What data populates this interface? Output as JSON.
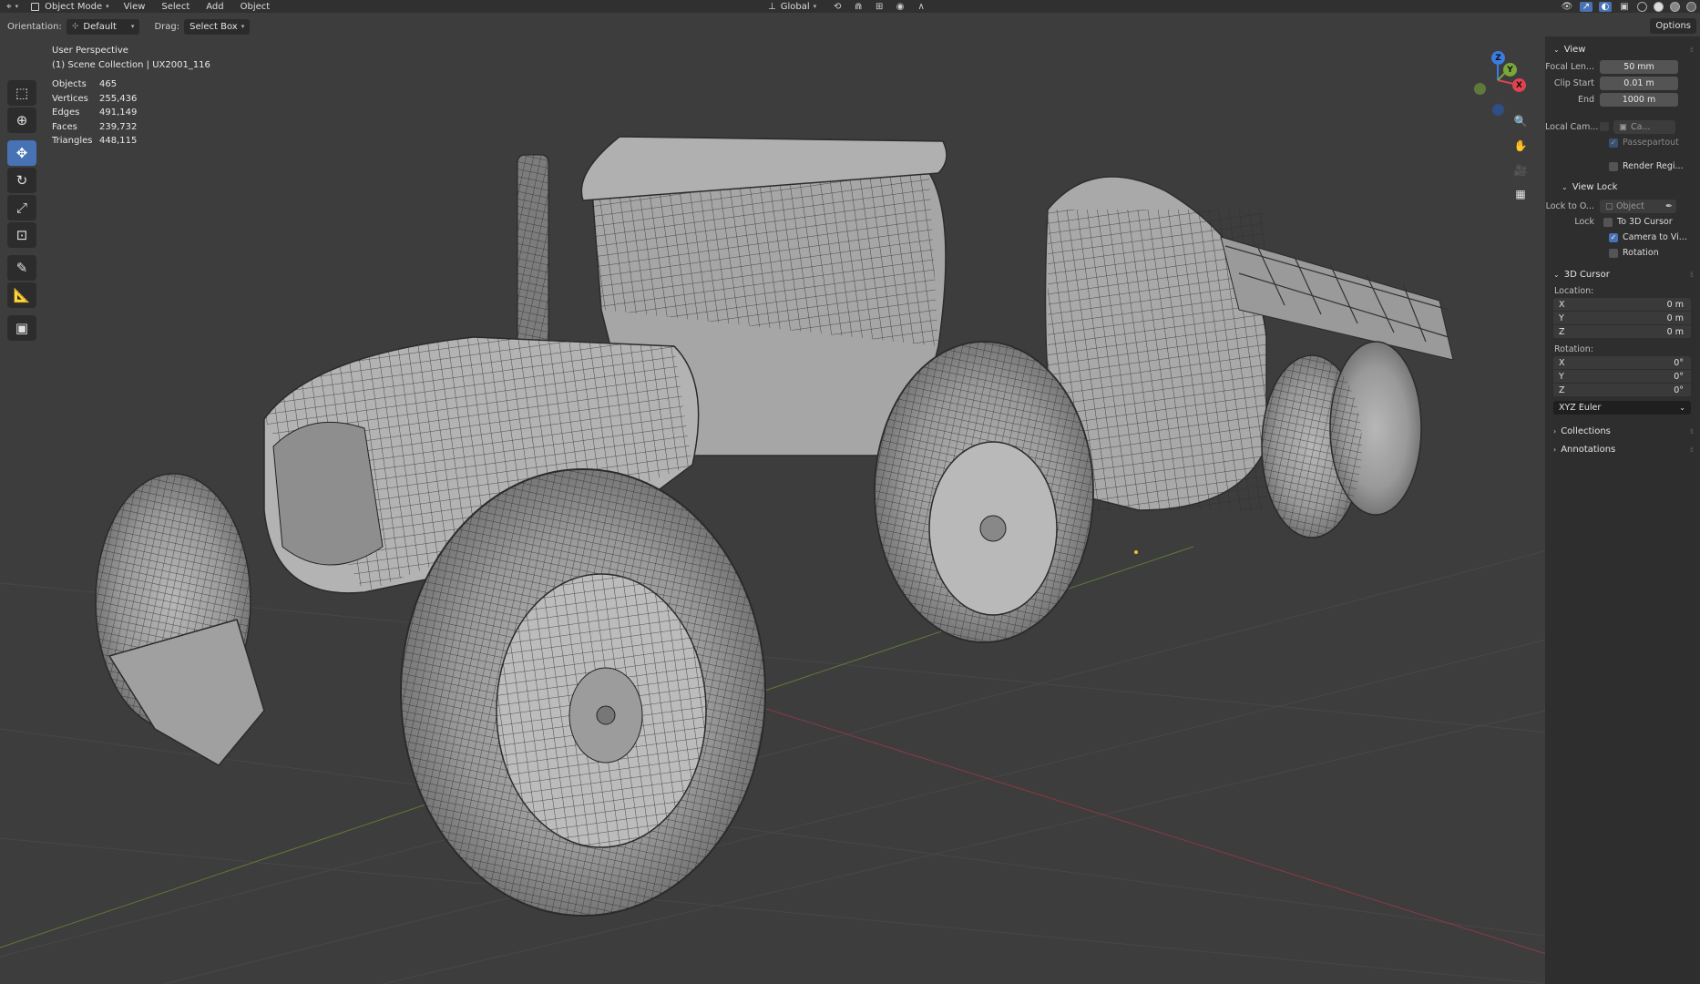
{
  "header": {
    "editor_icon": "cube-camera-icon",
    "mode": "Object Mode",
    "menus": [
      "View",
      "Select",
      "Add",
      "Object"
    ],
    "transform_orientation": "Global"
  },
  "tool_settings": {
    "orientation_label": "Orientation:",
    "orientation_value": "Default",
    "drag_label": "Drag:",
    "drag_value": "Select Box",
    "options_label": "Options"
  },
  "viewport": {
    "perspective": "User Perspective",
    "collection": "(1) Scene Collection | UX2001_116",
    "stats": [
      {
        "label": "Objects",
        "value": "465"
      },
      {
        "label": "Vertices",
        "value": "255,436"
      },
      {
        "label": "Edges",
        "value": "491,149"
      },
      {
        "label": "Faces",
        "value": "239,732"
      },
      {
        "label": "Triangles",
        "value": "448,115"
      }
    ],
    "gizmo": {
      "z": "Z",
      "x": "X",
      "y": "Y"
    },
    "colors": {
      "x_axis": "#e0434f",
      "y_axis": "#7aa63a",
      "z_axis": "#3a7de0",
      "background": "#3d3d3d"
    }
  },
  "npanel": {
    "view_section": "View",
    "focal_label": "Focal Len...",
    "focal_value": "50 mm",
    "clip_start_label": "Clip Start",
    "clip_start_value": "0.01 m",
    "end_label": "End",
    "end_value": "1000 m",
    "local_camera_label": "Local Cam...",
    "local_camera_value": "Ca...",
    "passepartout": "Passepartout",
    "render_region": "Render Regi...",
    "view_lock_section": "View Lock",
    "lock_to_label": "Lock to O...",
    "lock_to_placeholder": "Object",
    "lock_label": "Lock",
    "to_3d_cursor": "To 3D Cursor",
    "camera_to_view": "Camera to Vi...",
    "rotation_check": "Rotation",
    "cursor_section": "3D Cursor",
    "location_label": "Location:",
    "location": [
      {
        "axis": "X",
        "value": "0 m"
      },
      {
        "axis": "Y",
        "value": "0 m"
      },
      {
        "axis": "Z",
        "value": "0 m"
      }
    ],
    "rotation_label": "Rotation:",
    "rotation": [
      {
        "axis": "X",
        "value": "0°"
      },
      {
        "axis": "Y",
        "value": "0°"
      },
      {
        "axis": "Z",
        "value": "0°"
      }
    ],
    "rotation_mode": "XYZ Euler",
    "collections_section": "Collections",
    "annotations_section": "Annotations"
  },
  "accent_color": "#4772b3"
}
